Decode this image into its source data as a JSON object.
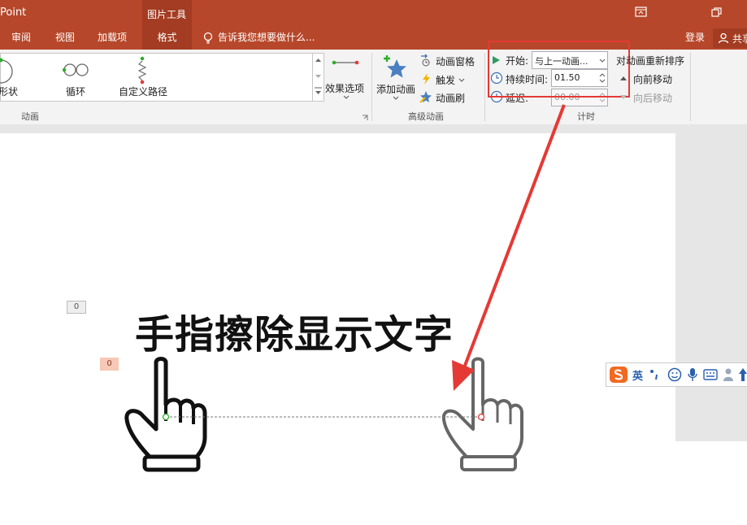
{
  "app": {
    "title_fragment": "Point",
    "context_tab_group": "图片工具"
  },
  "tabs": [
    {
      "label": "审阅"
    },
    {
      "label": "视图"
    },
    {
      "label": "加载项"
    },
    {
      "label": "格式"
    }
  ],
  "tell_me": "告诉我您想要做什么...",
  "login": "登录",
  "share": "共享",
  "gallery": {
    "items": [
      {
        "label": "形状"
      },
      {
        "label": "循环"
      },
      {
        "label": "自定义路径"
      }
    ]
  },
  "effect_options": "效果选项",
  "group_animation": "动画",
  "advanced": {
    "add_animation": "添加动画",
    "pane": "动画窗格",
    "trigger": "触发",
    "painter": "动画刷",
    "group_label": "高级动画"
  },
  "timing": {
    "start_label": "开始:",
    "start_value": "与上一动画...",
    "duration_label": "持续时间:",
    "duration_value": "01.50",
    "delay_label": "延迟:",
    "delay_value": "00.00",
    "reorder": "对动画重新排序",
    "move_earlier": "向前移动",
    "move_later": "向后移动",
    "group_label": "计时"
  },
  "slide": {
    "headline": "手指擦除显示文字",
    "badge_a": "0",
    "badge_b": "0"
  },
  "ime": {
    "lang": "英"
  },
  "colors": {
    "accent": "#b7472a",
    "highlight": "#e53935",
    "path_start": "#2bb02b",
    "path_end": "#e53935"
  }
}
